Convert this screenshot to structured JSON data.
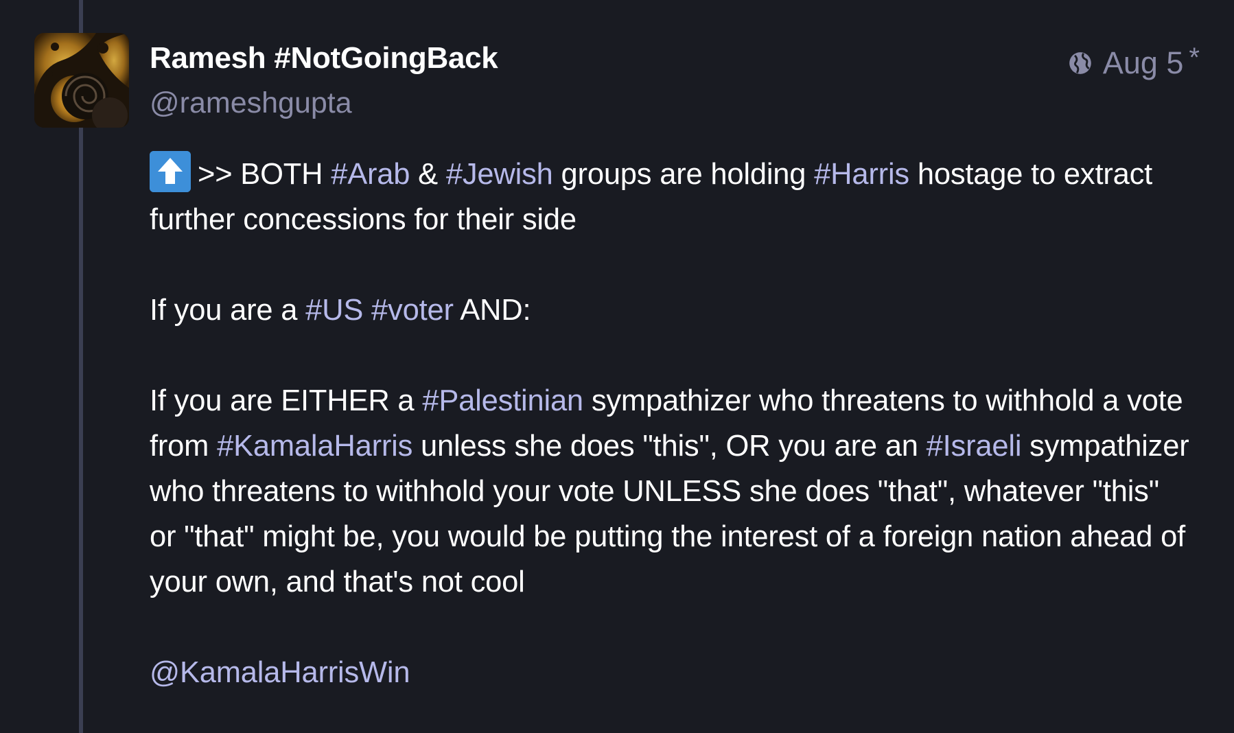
{
  "account": {
    "display_name": "Ramesh #NotGoingBack",
    "handle": "@rameshgupta",
    "avatar_icon": "fractal-avatar"
  },
  "meta": {
    "visibility_icon": "globe-icon",
    "timestamp": "Aug 5",
    "edited_marker": "*"
  },
  "post": {
    "paragraph1": {
      "emoji": "up-arrow-emoji",
      "t1": ">> BOTH ",
      "h1": "#Arab",
      "t2": " & ",
      "h2": "#Jewish",
      "t3": " groups are holding ",
      "h3": "#Harris",
      "t4": " hostage to extract further concessions for their side"
    },
    "paragraph2": {
      "t1": "If you are a ",
      "h1": "#US",
      "t2": " ",
      "h2": "#voter",
      "t3": " AND:"
    },
    "paragraph3": {
      "t1": "If you are EITHER a ",
      "h1": "#Palestinian",
      "t2": " sympathizer who threatens to withhold a vote from ",
      "h2": "#KamalaHarris",
      "t3": " unless she does \"this\", OR you are an ",
      "h3": "#Israeli",
      "t4": " sympathizer who threatens to withhold your vote UNLESS she does \"that\", whatever \"this\" or \"that\" might be, you would be putting the interest of a foreign nation ahead of your own, and that's not cool"
    },
    "paragraph4": {
      "mention": "@KamalaHarrisWin"
    }
  },
  "colors": {
    "background": "#191b22",
    "thread_line": "#3b3f52",
    "link": "#b6b9ea",
    "muted": "#8a8ba7",
    "text": "#ffffff"
  }
}
